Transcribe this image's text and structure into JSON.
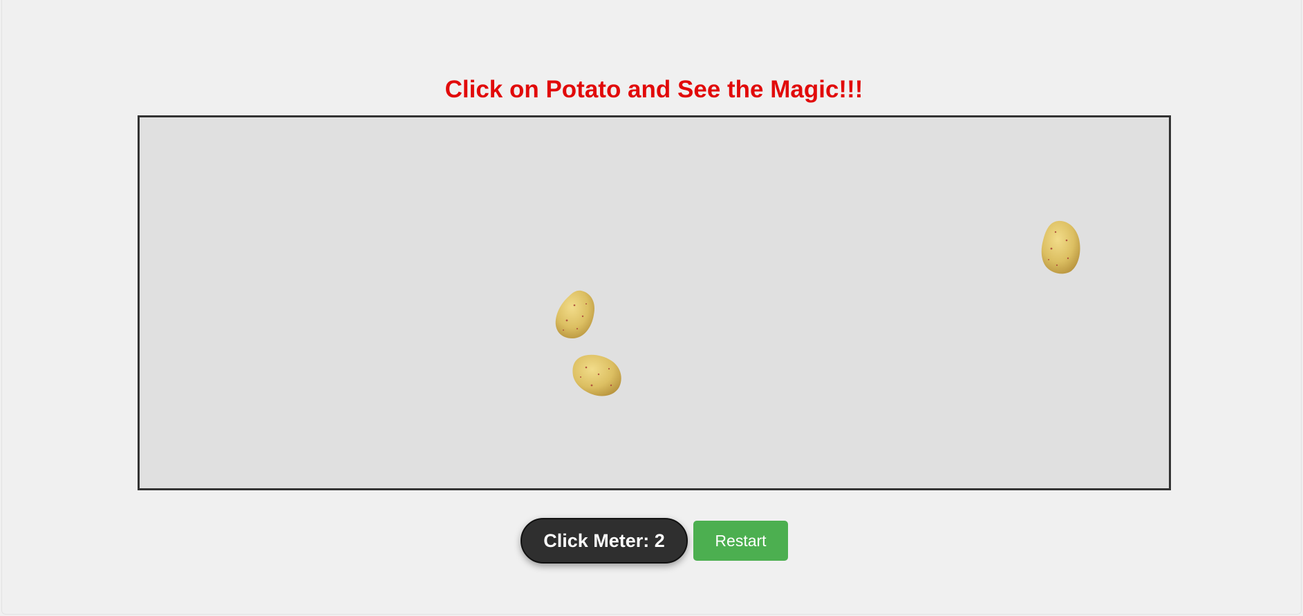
{
  "title": "Click on Potato and See the Magic!!!",
  "game": {
    "potatoes": [
      {
        "name": "potato-1"
      },
      {
        "name": "potato-2"
      },
      {
        "name": "potato-3"
      }
    ]
  },
  "controls": {
    "click_meter_label": "Click Meter: 2",
    "click_count": 2,
    "restart_label": "Restart"
  },
  "colors": {
    "page_background": "#f0f0f0",
    "title": "#e10a0a",
    "game_area_background": "#e0e0e0",
    "game_area_border": "#333333",
    "click_meter_background": "#2f2f2f",
    "restart_background": "#4caf50",
    "potato_skin": "#dcbf62"
  },
  "icons": {
    "potato": "potato-icon"
  }
}
